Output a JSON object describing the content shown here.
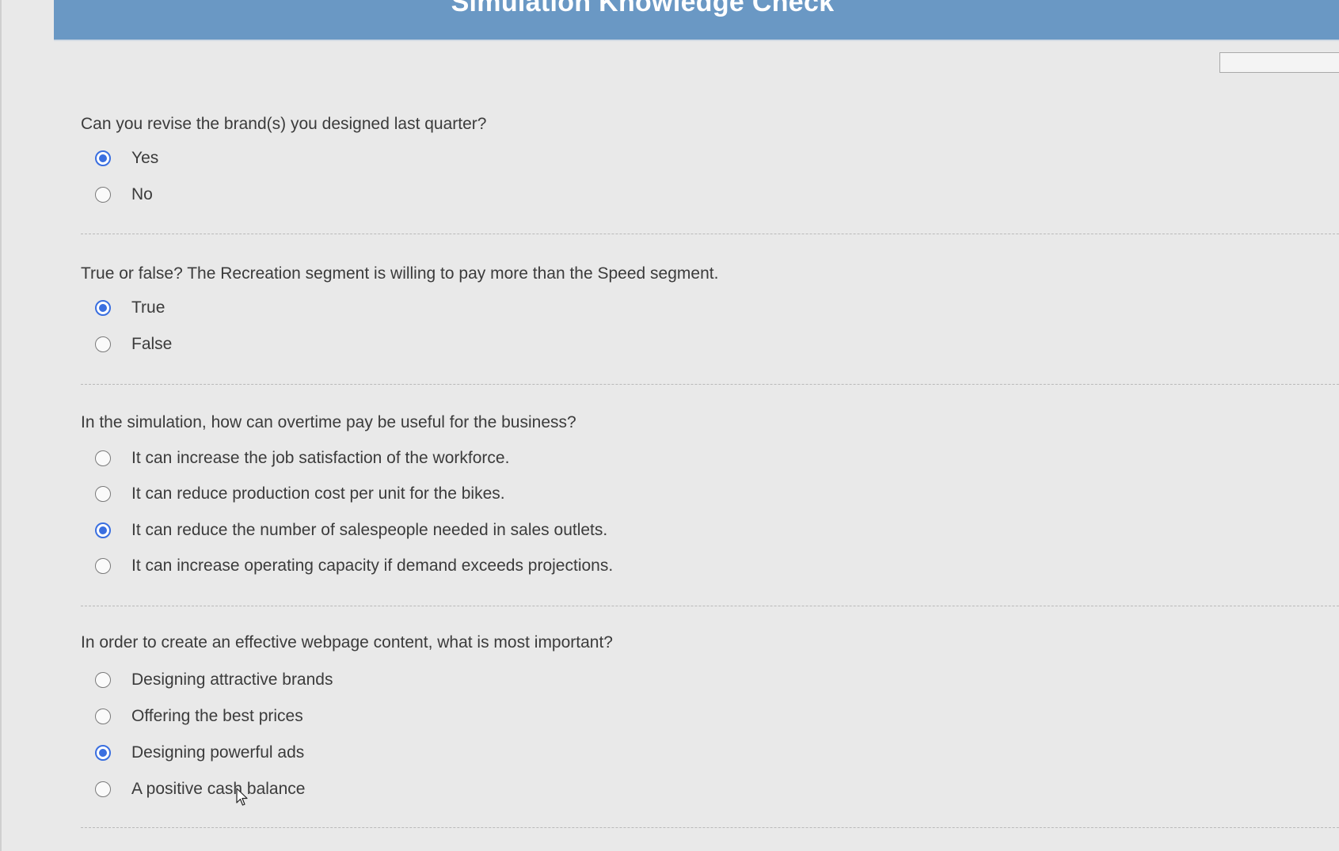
{
  "header": {
    "title": "Simulation Knowledge Check"
  },
  "questions": [
    {
      "text": "Can you revise the brand(s) you designed last quarter?",
      "options": [
        {
          "label": "Yes",
          "selected": true
        },
        {
          "label": "No",
          "selected": false
        }
      ]
    },
    {
      "text": "True or false? The Recreation segment is willing to pay more than the Speed segment.",
      "options": [
        {
          "label": "True",
          "selected": true
        },
        {
          "label": "False",
          "selected": false
        }
      ]
    },
    {
      "text": "In the simulation, how can overtime pay be useful for the business?",
      "options": [
        {
          "label": "It can increase the job satisfaction of the workforce.",
          "selected": false
        },
        {
          "label": "It can reduce production cost per unit for the bikes.",
          "selected": false
        },
        {
          "label": "It can reduce the number of salespeople needed in sales outlets.",
          "selected": true
        },
        {
          "label": "It can increase operating capacity if demand exceeds projections.",
          "selected": false
        }
      ]
    },
    {
      "text": "In order to create an effective webpage content, what is most important?",
      "options": [
        {
          "label": "Designing attractive brands",
          "selected": false
        },
        {
          "label": "Offering the best prices",
          "selected": false
        },
        {
          "label": "Designing powerful ads",
          "selected": true
        },
        {
          "label": "A positive cash balance",
          "selected": false
        }
      ]
    }
  ],
  "colors": {
    "header_bg": "#6a98c4",
    "radio_selected": "#3a6fe0"
  }
}
